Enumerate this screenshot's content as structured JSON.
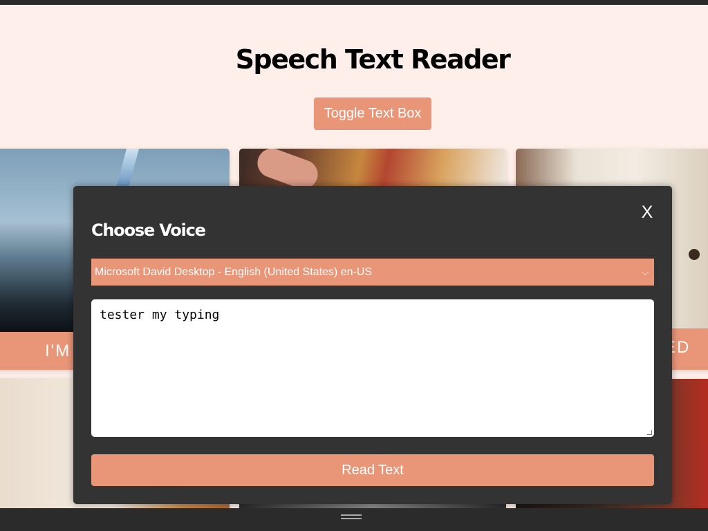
{
  "page": {
    "title": "Speech Text Reader",
    "toggle_label": "Toggle Text Box"
  },
  "cards": [
    {
      "label": "I'M"
    },
    {
      "label": "ED"
    }
  ],
  "modal": {
    "close_label": "X",
    "title": "Choose Voice",
    "voice_selected": "Microsoft David Desktop - English (United States) en-US",
    "text_value": "tester my typing",
    "read_label": "Read Text"
  },
  "colors": {
    "accent": "#e99578",
    "background": "#ffefea",
    "modal": "#333333"
  },
  "icons": {
    "chevron": "chevron-down-icon",
    "handle": "drag-handle-icon"
  }
}
